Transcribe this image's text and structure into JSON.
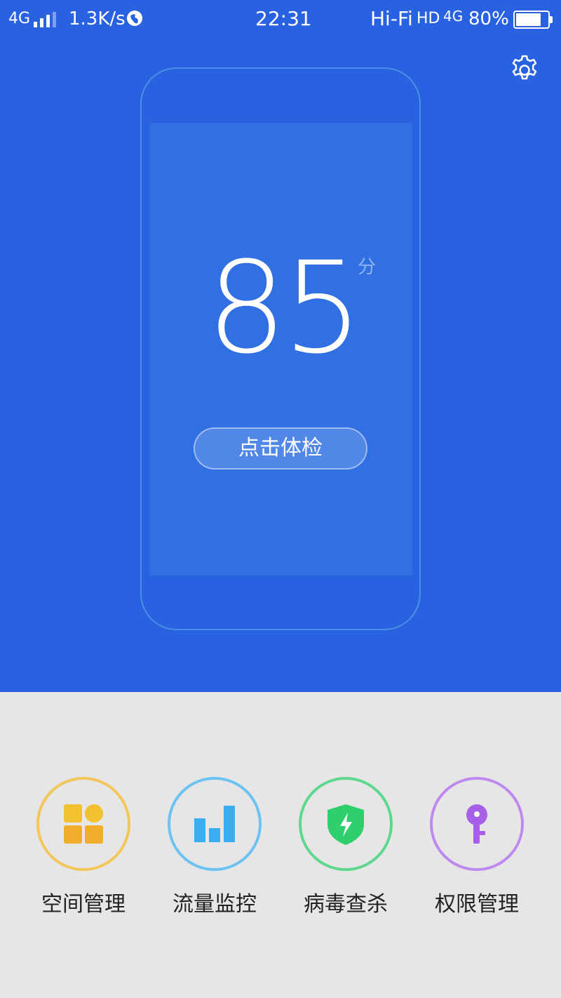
{
  "colors": {
    "header_bg": "#2962e0",
    "screen_bg": "#3070e3",
    "bottom_bg": "#e6e6e6",
    "space_accent": "#f3b531",
    "traffic_accent": "#4ab8f2",
    "virus_accent": "#3ed37c",
    "permission_accent": "#b173ea"
  },
  "status_bar": {
    "network": "4G",
    "speed": "1.3K/s",
    "time": "22:31",
    "hifi": "Hi-Fi",
    "hd": "HD",
    "network2": "4G",
    "battery_text": "80%",
    "battery_level": 0.8
  },
  "header": {
    "settings_icon": "gear-icon"
  },
  "score": {
    "value": "85",
    "unit": "分",
    "button_label": "点击体检"
  },
  "features": [
    {
      "label": "空间管理",
      "icon": "grid-icon"
    },
    {
      "label": "流量监控",
      "icon": "bar-chart-icon"
    },
    {
      "label": "病毒查杀",
      "icon": "shield-bolt-icon"
    },
    {
      "label": "权限管理",
      "icon": "key-icon"
    }
  ]
}
